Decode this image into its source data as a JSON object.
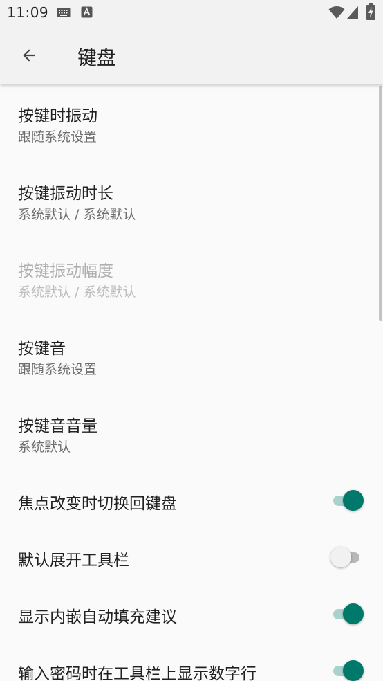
{
  "status_bar": {
    "time": "11:09",
    "icons": [
      "keyboard-icon",
      "a-input-icon",
      "wifi-icon",
      "signal-icon",
      "battery-charging-icon"
    ]
  },
  "app_bar": {
    "title": "键盘",
    "back_icon": "arrow-left-icon"
  },
  "colors": {
    "accent": "#00796b",
    "accent_track": "#a8d3cd"
  },
  "settings": [
    {
      "title": "按键时振动",
      "summary": "跟随系统设置"
    },
    {
      "title": "按键振动时长",
      "summary": "系统默认 / 系统默认"
    },
    {
      "title": "按键振动幅度",
      "summary": "系统默认 / 系统默认",
      "enabled": false
    },
    {
      "title": "按键音",
      "summary": "跟随系统设置"
    },
    {
      "title": "按键音音量",
      "summary": "系统默认"
    },
    {
      "title": "焦点改变时切换回键盘",
      "switch_on": true
    },
    {
      "title": "默认展开工具栏",
      "switch_on": false
    },
    {
      "title": "显示内嵌自动填充建议",
      "switch_on": true
    },
    {
      "title": "输入密码时在工具栏上显示数字行",
      "switch_on": true
    }
  ]
}
